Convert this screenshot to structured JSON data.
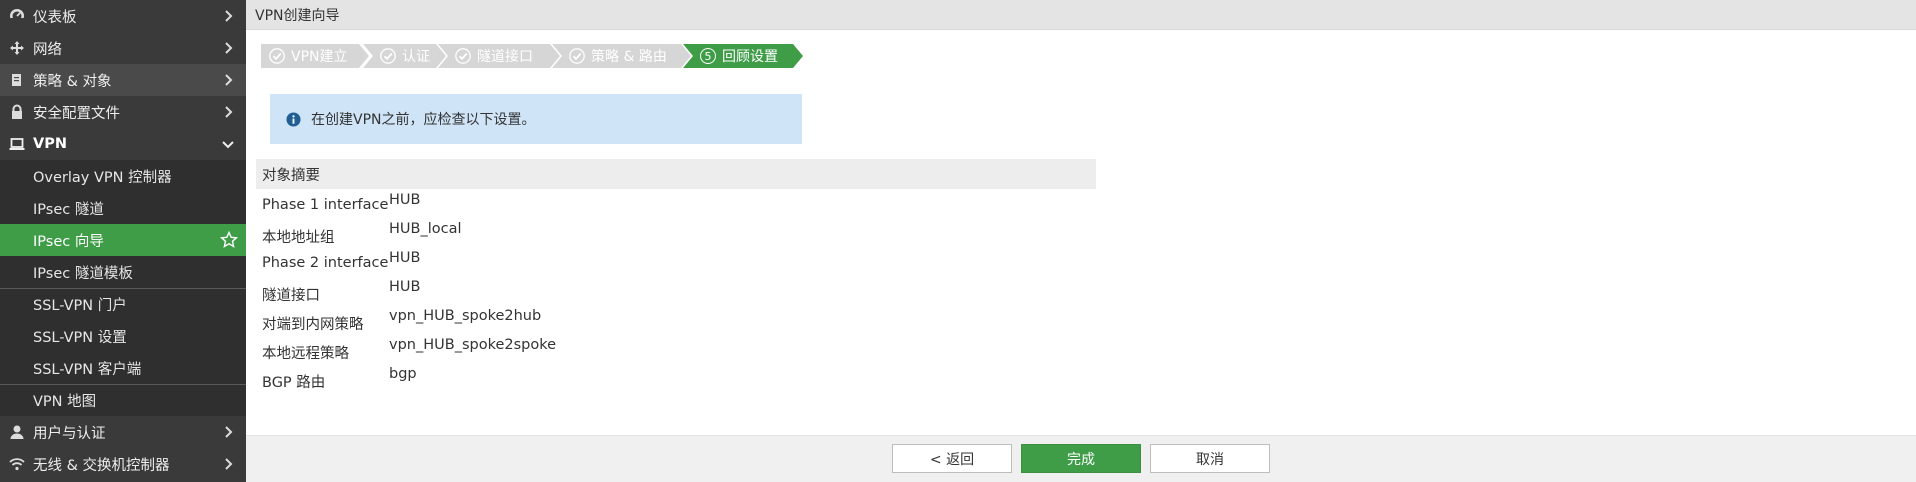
{
  "sidebar": {
    "top_items": [
      {
        "label": "仪表板",
        "icon": "dashboard-icon"
      },
      {
        "label": "网络",
        "icon": "network-icon"
      },
      {
        "label": "策略 & 对象",
        "icon": "policy-icon"
      },
      {
        "label": "安全配置文件",
        "icon": "lock-icon"
      },
      {
        "label": "VPN",
        "icon": "laptop-icon"
      }
    ],
    "vpn_children": [
      {
        "label": "Overlay VPN 控制器"
      },
      {
        "label": "IPsec 隧道"
      },
      {
        "label": "IPsec 向导",
        "active": true
      },
      {
        "label": "IPsec 隧道模板"
      },
      {
        "label": "SSL-VPN 门户"
      },
      {
        "label": "SSL-VPN 设置"
      },
      {
        "label": "SSL-VPN 客户端"
      },
      {
        "label": "VPN 地图"
      }
    ],
    "bottom_items": [
      {
        "label": "用户与认证",
        "icon": "user-icon"
      },
      {
        "label": "无线 & 交换机控制器",
        "icon": "wifi-icon"
      }
    ]
  },
  "header": {
    "title": "VPN创建向导"
  },
  "wizard": {
    "steps": [
      {
        "label": "VPN建立",
        "state": "done"
      },
      {
        "label": "认证",
        "state": "done"
      },
      {
        "label": "隧道接口",
        "state": "done"
      },
      {
        "label": "策略 & 路由",
        "state": "done"
      },
      {
        "label": "回顾设置",
        "state": "current",
        "number": "5"
      }
    ]
  },
  "info": {
    "message": "在创建VPN之前，应检查以下设置。"
  },
  "summary": {
    "title": "对象摘要",
    "rows": [
      {
        "key": "Phase 1 interface",
        "value": "HUB"
      },
      {
        "key": "本地地址组",
        "value": "HUB_local"
      },
      {
        "key": "Phase 2 interface",
        "value": "HUB"
      },
      {
        "key": "隧道接口",
        "value": "HUB"
      },
      {
        "key": "对端到内网策略",
        "value": "vpn_HUB_spoke2hub"
      },
      {
        "key": "本地远程策略",
        "value": "vpn_HUB_spoke2spoke"
      },
      {
        "key": "BGP 路由",
        "value": "bgp"
      }
    ]
  },
  "footer": {
    "back_label": "< 返回",
    "finish_label": "完成",
    "cancel_label": "取消"
  },
  "colors": {
    "accent": "#3f9d48",
    "sidebar_bg": "#3a3a3a",
    "step_done": "#d6d6d6",
    "info_bg": "#cfe4f7"
  }
}
